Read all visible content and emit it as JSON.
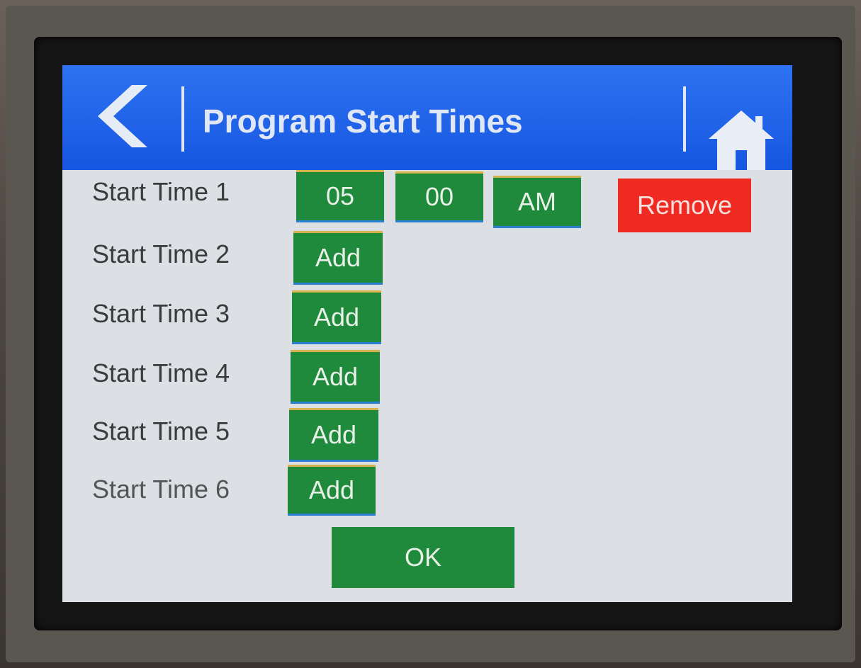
{
  "header": {
    "title": "Program Start Times"
  },
  "start_time_1": {
    "label": "Start Time 1",
    "hour": "05",
    "minute": "00",
    "period": "AM",
    "remove_label": "Remove"
  },
  "rows": [
    {
      "label": "Start Time 2",
      "add_label": "Add"
    },
    {
      "label": "Start Time 3",
      "add_label": "Add"
    },
    {
      "label": "Start Time 4",
      "add_label": "Add"
    },
    {
      "label": "Start Time 5",
      "add_label": "Add"
    },
    {
      "label": "Start Time 6",
      "add_label": "Add"
    }
  ],
  "ok_label": "OK",
  "colors": {
    "header": "#1a5ae8",
    "button_green": "#1f8a3c",
    "button_red": "#ee2a22",
    "screen_bg": "#dcdfe4"
  },
  "icons": {
    "back": "chevron-left-icon",
    "home": "home-icon"
  }
}
